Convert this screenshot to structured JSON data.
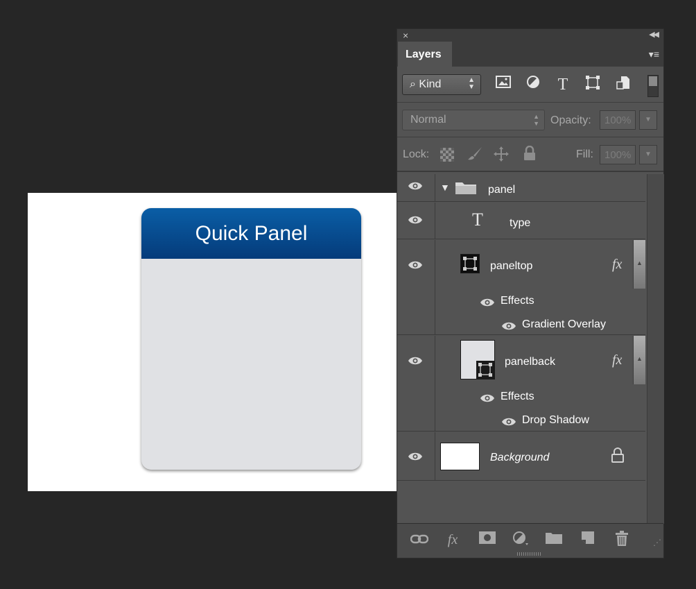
{
  "canvas": {
    "quick_panel_title": "Quick Panel"
  },
  "panel": {
    "close_glyph": "×",
    "collapse_glyph": "◀◀",
    "tab_label": "Layers",
    "menu_glyph": "▾≡",
    "filter": {
      "kind_label": "Kind",
      "search_glyph": "⌕",
      "icons": [
        "image-filter-icon",
        "adjustment-filter-icon",
        "type-filter-icon",
        "shape-filter-icon",
        "smart-object-filter-icon"
      ]
    },
    "blend": {
      "mode": "Normal",
      "opacity_label": "Opacity:",
      "opacity_value": "100%"
    },
    "lock": {
      "lock_label": "Lock:",
      "fill_label": "Fill:",
      "fill_value": "100%"
    },
    "layers": [
      {
        "name": "panel",
        "kind": "group"
      },
      {
        "name": "type",
        "kind": "text"
      },
      {
        "name": "paneltop",
        "kind": "shape",
        "fx": "fx",
        "effects_label": "Effects",
        "effect": "Gradient Overlay"
      },
      {
        "name": "panelback",
        "kind": "shape",
        "fx": "fx",
        "effects_label": "Effects",
        "effect": "Drop Shadow"
      },
      {
        "name": "Background",
        "kind": "background",
        "locked": true
      }
    ],
    "text_glyph": "T",
    "bottom_icons": [
      "link-layers-icon",
      "add-layer-style-icon",
      "add-mask-icon",
      "new-adjustment-layer-icon",
      "new-group-icon",
      "new-layer-icon",
      "delete-layer-icon"
    ]
  },
  "colors": {
    "app_bg": "#262626",
    "panel_bg": "#535353",
    "quick_panel_header": "#0a5ea6",
    "quick_panel_body": "#e0e1e4"
  }
}
